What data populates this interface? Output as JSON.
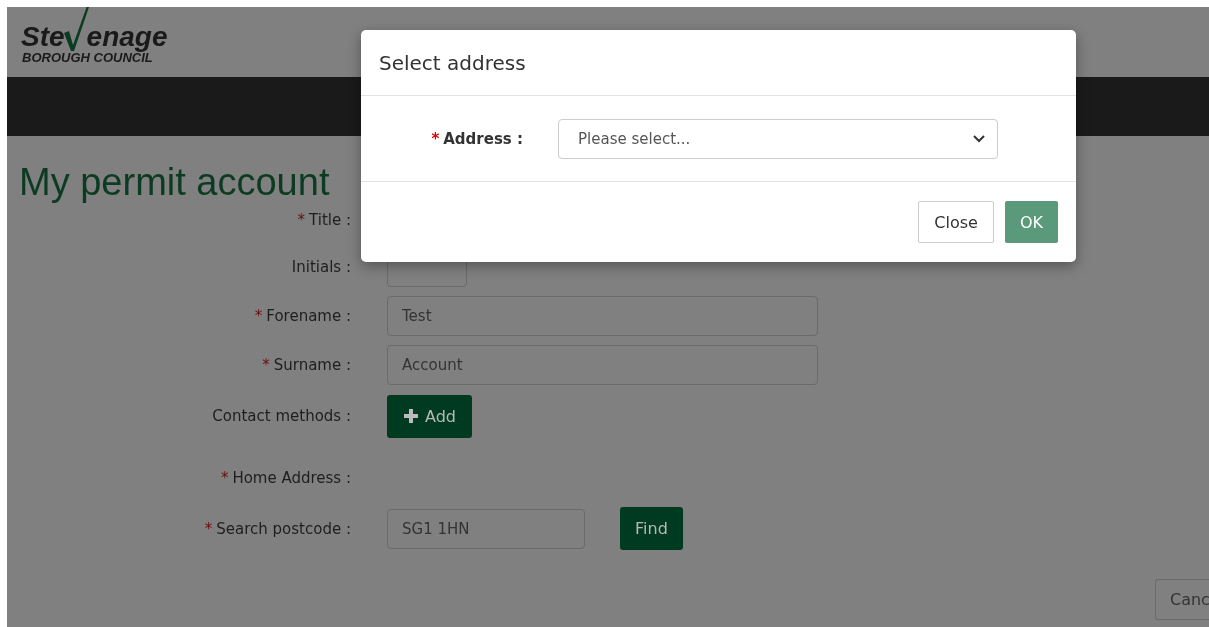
{
  "logo": {
    "name_start": "Ste",
    "name_end": "enage",
    "subtitle": "BOROUGH COUNCIL"
  },
  "heading": "My permit account",
  "form": [
    {
      "kind": "label",
      "label": "Title :",
      "required_mark": "*"
    },
    {
      "kind": "short_input",
      "label": "Initials :"
    },
    {
      "kind": "input",
      "label": "Forename :",
      "required_mark": "*",
      "value": "Test"
    },
    {
      "kind": "input",
      "label": "Surname :",
      "required_mark": "*",
      "value": "Account"
    },
    {
      "kind": "add",
      "label": "Contact methods :",
      "button": "Add"
    },
    {
      "kind": "label",
      "label": "Home Address :",
      "required_mark": "*"
    },
    {
      "kind": "search",
      "label": "Search postcode :",
      "required_mark": "*",
      "value": "SG1 1HN",
      "button": "Find"
    }
  ],
  "cancel_button": "Canc",
  "modal": {
    "title": "Select address",
    "field": {
      "label": "Address :",
      "required_mark": "*",
      "value": "Please select..."
    },
    "buttons": [
      {
        "label": "Close",
        "primary": false
      },
      {
        "label": "OK",
        "primary": true
      }
    ]
  }
}
